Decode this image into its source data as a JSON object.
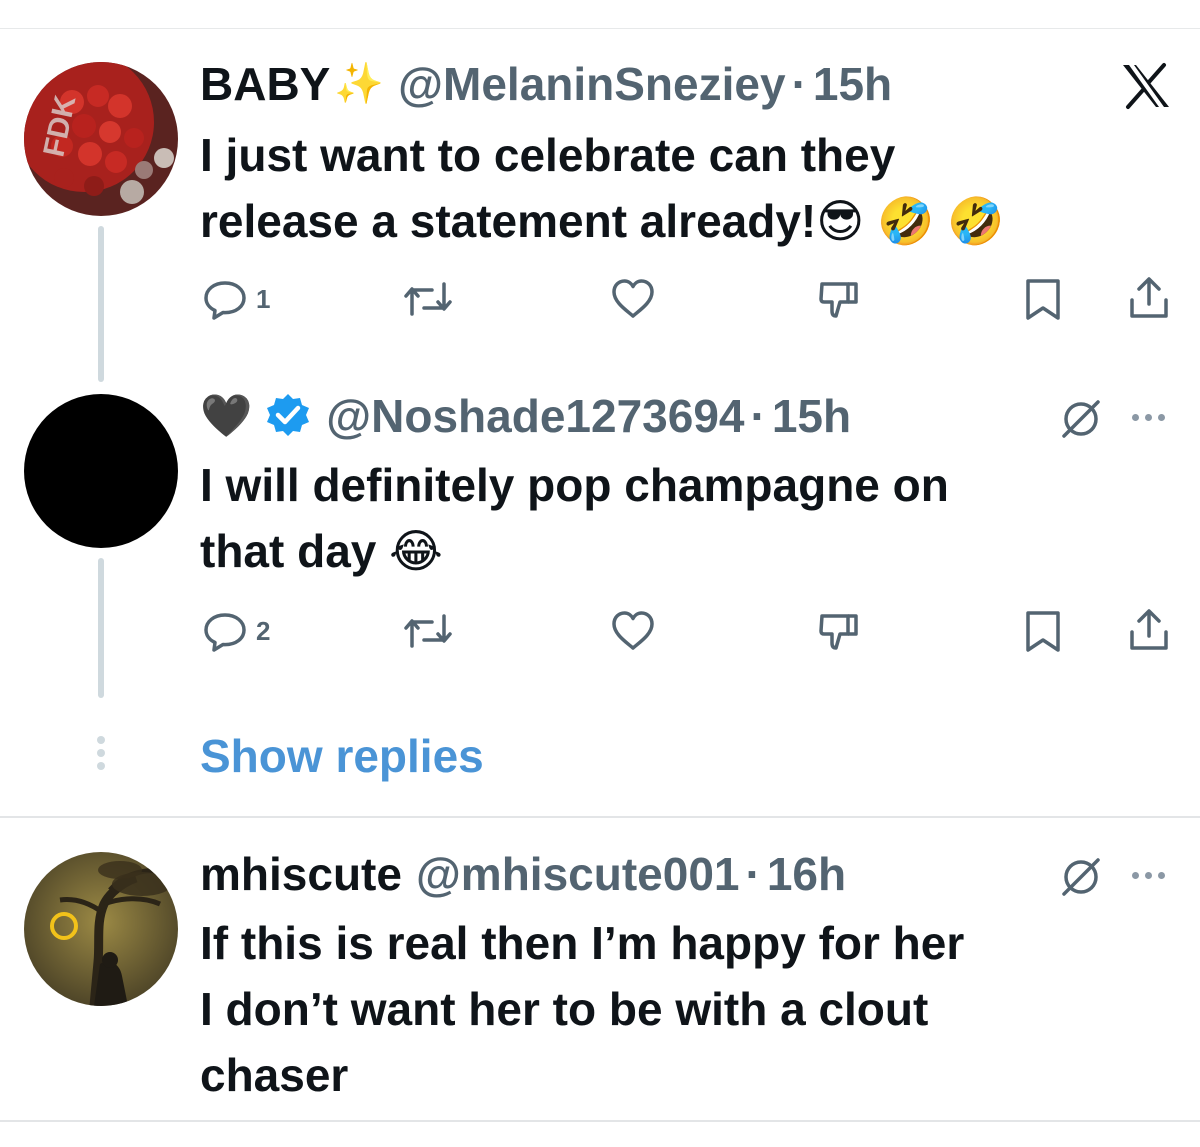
{
  "tweets": [
    {
      "name": "BABY",
      "name_emoji": "✨",
      "handle": "@MelaninSneziey",
      "dot": "·",
      "time": "15h",
      "lines": [
        "I just want to celebrate can they",
        "release a statement already!😎 🤣 🤣"
      ],
      "reply_count": "1",
      "top_right_icon": "x-logo-icon"
    },
    {
      "name": "🖤",
      "verified": true,
      "handle": "@Noshade1273694",
      "dot": "·",
      "time": "15h",
      "lines": [
        "I will definitely pop champagne on",
        "that day 😂"
      ],
      "reply_count": "2",
      "top_right_icon": "grok-icon"
    },
    {
      "name": "mhiscute",
      "handle": "@mhiscute001",
      "dot": "·",
      "time": "16h",
      "lines": [
        "If this is real then I’m happy for her",
        "I don’t want her to be with a clout",
        "chaser"
      ],
      "top_right_icon": "grok-icon"
    }
  ],
  "show_replies_label": "Show replies",
  "colors": {
    "text": "#0f1419",
    "secondary": "#536471",
    "link": "#4a94d6",
    "verified": "#1d9bf0",
    "thread_line": "#cfd9de"
  },
  "action_icons": [
    "reply-icon",
    "retweet-icon",
    "like-icon",
    "dislike-icon",
    "bookmark-icon",
    "share-icon"
  ]
}
